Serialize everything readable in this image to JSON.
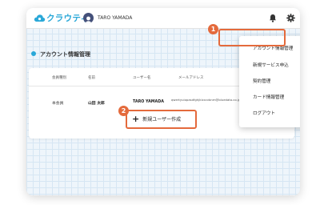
{
  "header": {
    "app_name": "クラウティ",
    "user_name": "TARO YAMADA"
  },
  "section": {
    "title": "アカウント情報管理"
  },
  "table": {
    "columns": [
      "会員種別",
      "名前",
      "ユーザー名",
      "メールアドレス"
    ],
    "rows": [
      {
        "member_type": "本会員",
        "name": "山田 太郎",
        "username": "TARO YAMADA",
        "email": "qwertyuiopasdfghjklzxcvbnm@bluedata.co.jp"
      }
    ]
  },
  "create_button": {
    "label": "新規ユーザー作成"
  },
  "dropdown": {
    "items": [
      "アカウント情報管理",
      "新規サービス申込",
      "契約管理",
      "カード情報管理",
      "ログアウト"
    ]
  },
  "badges": [
    "1",
    "2"
  ],
  "colors": {
    "accent": "#2aa8d8",
    "highlight": "#e46a3c"
  }
}
